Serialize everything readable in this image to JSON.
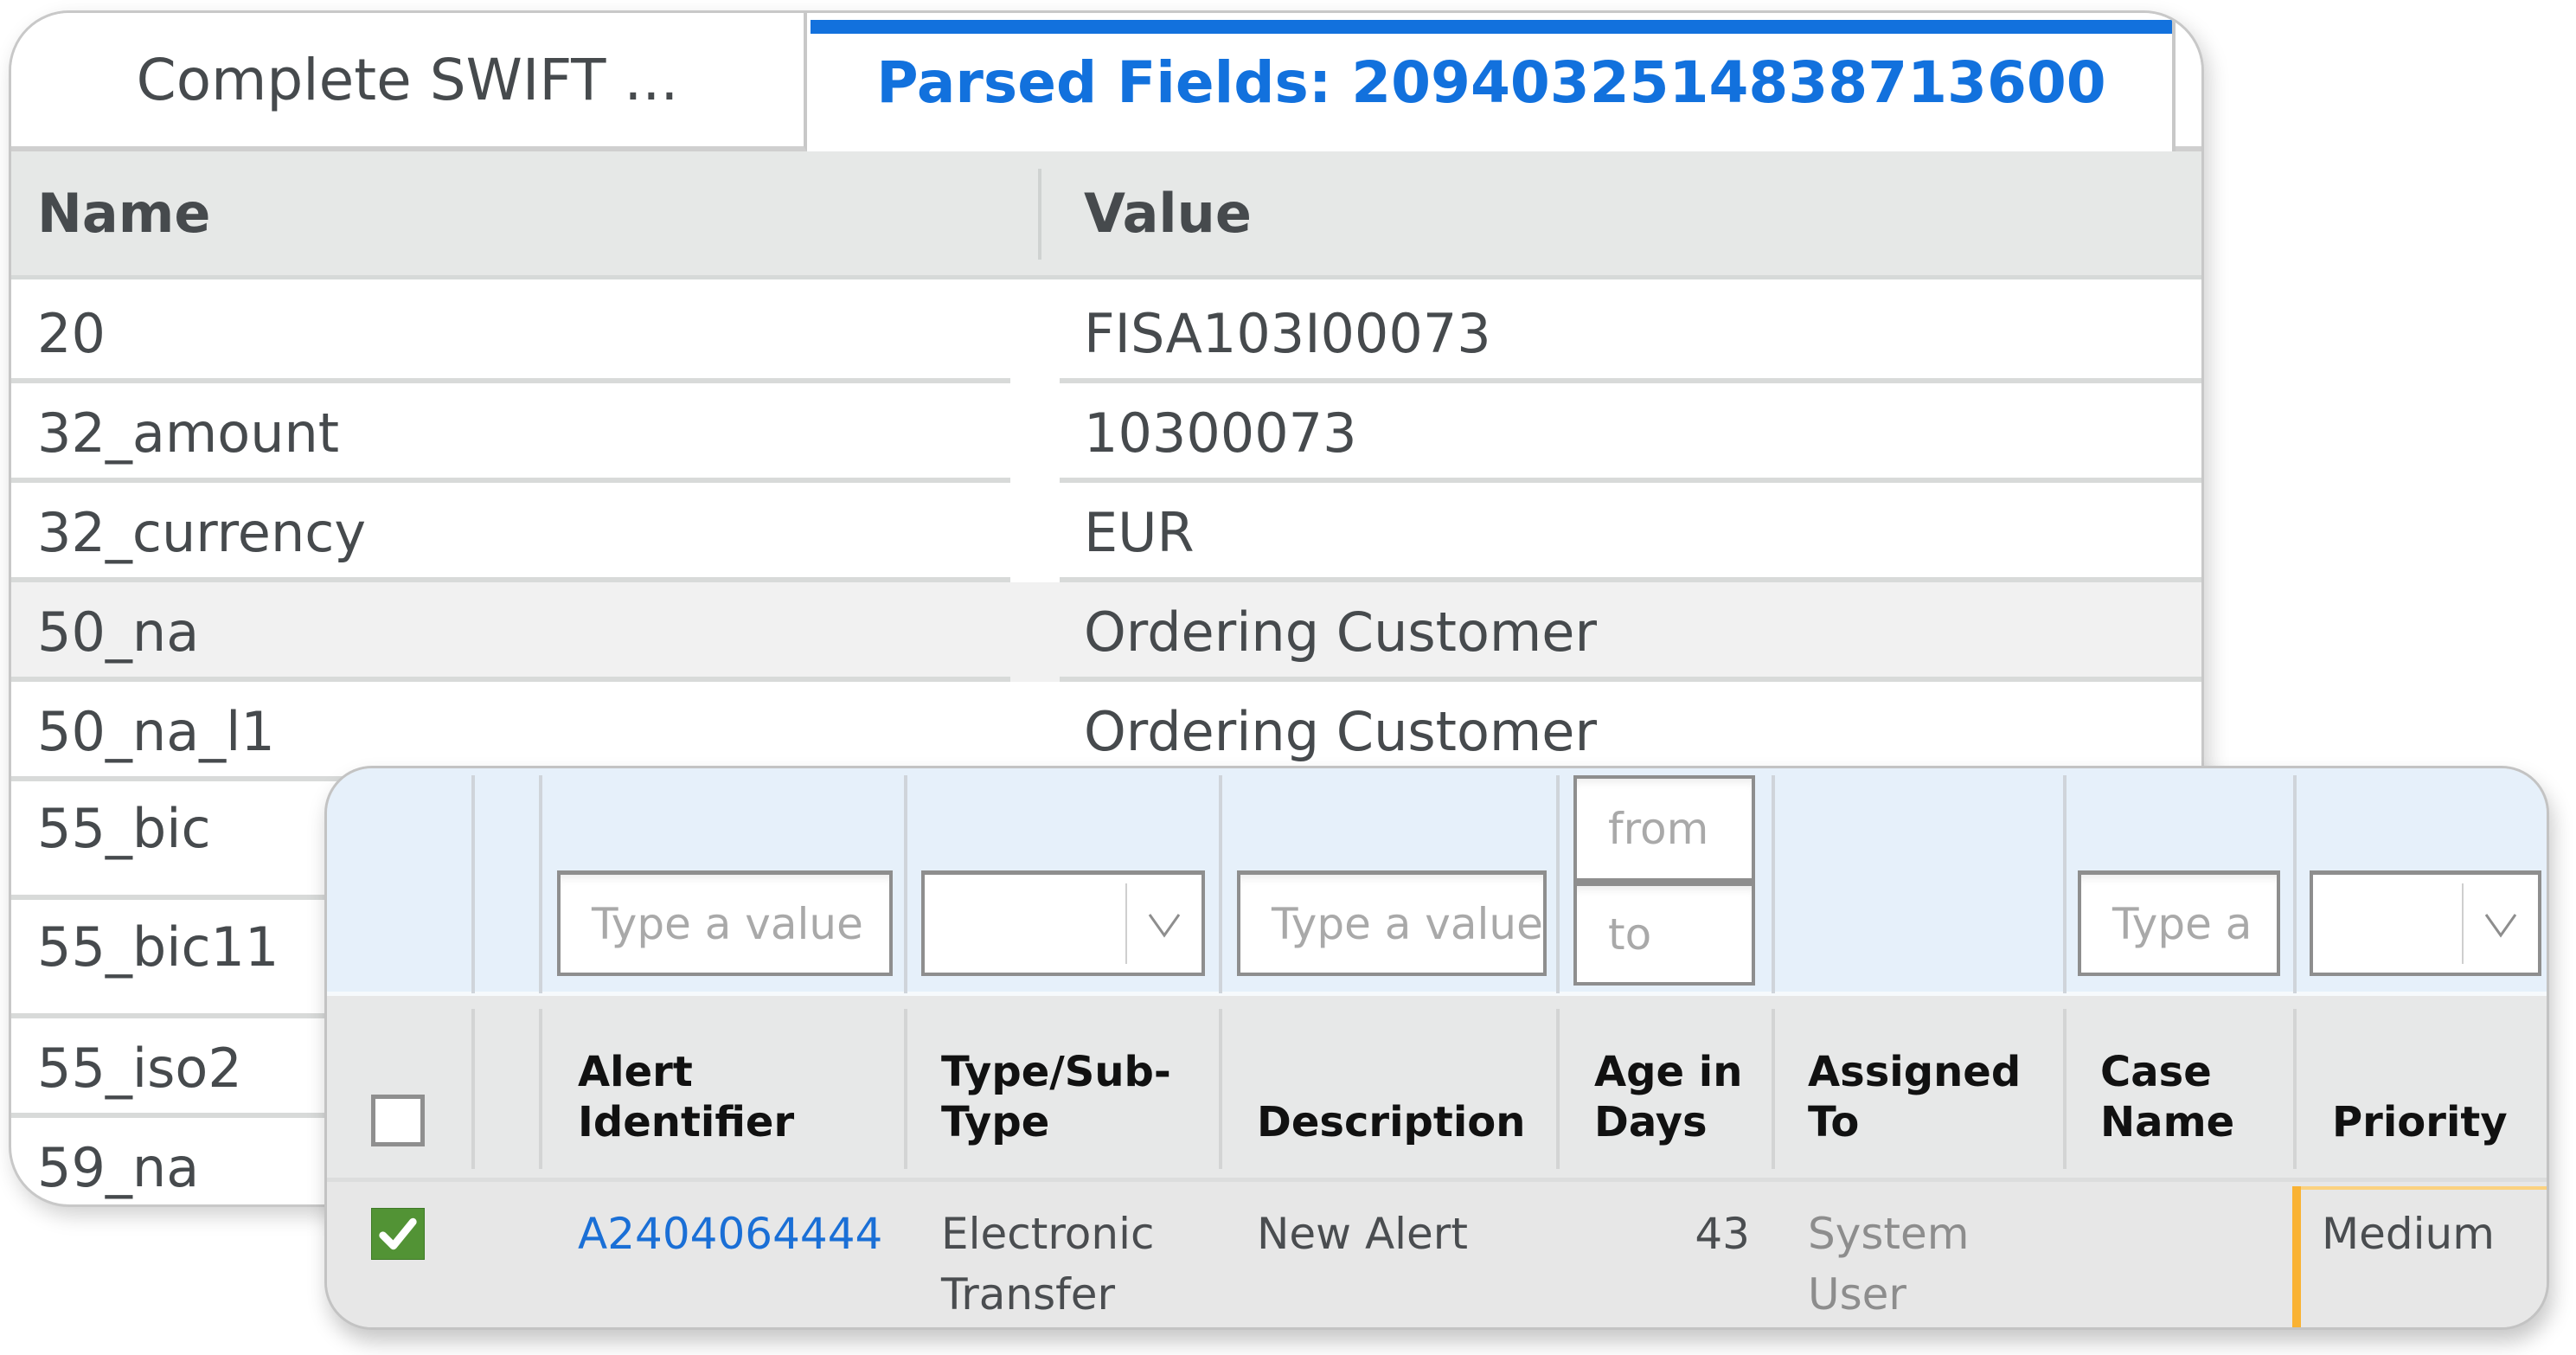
{
  "parsed_fields": {
    "tabs": [
      {
        "label": "Complete SWIFT ...",
        "active": false
      },
      {
        "label": "Parsed Fields: 2094032514838713600",
        "active": true
      }
    ],
    "columns": {
      "name": "Name",
      "value": "Value"
    },
    "rows": [
      {
        "name": "20",
        "value": "FISA103I00073"
      },
      {
        "name": "32_amount",
        "value": "10300073"
      },
      {
        "name": "32_currency",
        "value": "EUR"
      },
      {
        "name": "50_na",
        "value": "Ordering Customer"
      },
      {
        "name": "50_na_l1",
        "value": "Ordering Customer"
      },
      {
        "name": "55_bic",
        "value": ""
      },
      {
        "name": "55_bic11",
        "value": ""
      },
      {
        "name": "55_iso2",
        "value": ""
      },
      {
        "name": "59_na",
        "value": ""
      }
    ]
  },
  "alerts": {
    "filters": {
      "alert_identifier_placeholder": "Type a value",
      "type_select_value": "",
      "description_placeholder": "Type a value",
      "age_from_placeholder": "from",
      "age_to_placeholder": "to",
      "case_name_placeholder": "Type a",
      "priority_select_value": ""
    },
    "columns": {
      "alert_identifier": "Alert Identifier",
      "type_subtype": "Type/Sub-Type",
      "description": "Description",
      "age_in_days": "Age in Days",
      "assigned_to": "Assigned To",
      "case_name": "Case Name",
      "priority": "Priority"
    },
    "select_all_checked": false,
    "rows": [
      {
        "checked": true,
        "alert_identifier": "A2404064444",
        "type_subtype": "Electronic Transfer",
        "description": "New Alert",
        "age_in_days": "43",
        "assigned_to": "System User",
        "case_name": "",
        "priority": "Medium",
        "priority_color": "#f9b233"
      }
    ]
  },
  "colors": {
    "accent_blue": "#1271dd",
    "link_blue": "#1a6fd6",
    "check_green": "#529335",
    "priority_medium": "#f9b233",
    "filter_bg": "#e6f0fa"
  }
}
